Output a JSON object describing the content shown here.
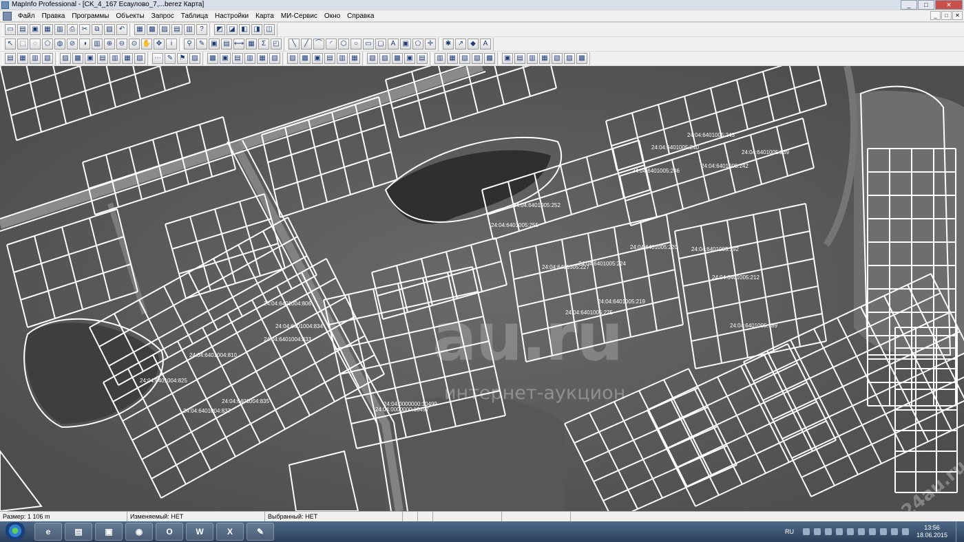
{
  "window": {
    "title": "MapInfo Professional - [CK_4_167 Есаулово_7,...berez Карта]",
    "controls": [
      "_",
      "□",
      "✕"
    ]
  },
  "menu": {
    "items": [
      "Файл",
      "Правка",
      "Программы",
      "Объекты",
      "Запрос",
      "Таблица",
      "Настройки",
      "Карта",
      "МИ-Сервис",
      "Окно",
      "Справка"
    ],
    "mdi_controls": [
      "_",
      "□",
      "✕"
    ]
  },
  "toolbars": {
    "row1": [
      {
        "name": "new-button",
        "glyph": "▭"
      },
      {
        "name": "open-button",
        "glyph": "▤"
      },
      {
        "name": "save-button",
        "glyph": "▣"
      },
      {
        "name": "save-copy-button",
        "glyph": "▦"
      },
      {
        "name": "print-preview-button",
        "glyph": "▥"
      },
      {
        "name": "print-button",
        "glyph": "⎙"
      },
      {
        "name": "cut-button",
        "glyph": "✂"
      },
      {
        "name": "copy-button",
        "glyph": "⧉"
      },
      {
        "name": "paste-button",
        "glyph": "▧"
      },
      {
        "name": "undo-button",
        "glyph": "↶"
      },
      {
        "name": "new-browser-button",
        "glyph": "▦"
      },
      {
        "name": "new-map-button",
        "glyph": "▩"
      },
      {
        "name": "new-graph-button",
        "glyph": "▨"
      },
      {
        "name": "new-layout-button",
        "glyph": "▤"
      },
      {
        "name": "new-redistrict-button",
        "glyph": "▥"
      },
      {
        "name": "help-button",
        "glyph": "?"
      },
      {
        "name": "tool-a-button",
        "glyph": "◩"
      },
      {
        "name": "tool-b-button",
        "glyph": "◪"
      },
      {
        "name": "tool-c-button",
        "glyph": "◧"
      },
      {
        "name": "tool-d-button",
        "glyph": "◨"
      },
      {
        "name": "tool-e-button",
        "glyph": "◫"
      }
    ],
    "row2": [
      {
        "name": "select-tool",
        "glyph": "↖"
      },
      {
        "name": "marquee-select-tool",
        "glyph": "⬚"
      },
      {
        "name": "radius-select-tool",
        "glyph": "◌"
      },
      {
        "name": "polygon-select-tool",
        "glyph": "⬠"
      },
      {
        "name": "boundary-select-tool",
        "glyph": "◍"
      },
      {
        "name": "unselect-all-tool",
        "glyph": "⊘"
      },
      {
        "name": "invert-selection-tool",
        "glyph": "◑"
      },
      {
        "name": "graph-select-tool",
        "glyph": "▥"
      },
      {
        "name": "zoom-in-tool",
        "glyph": "⊕"
      },
      {
        "name": "zoom-out-tool",
        "glyph": "⊖"
      },
      {
        "name": "change-view-tool",
        "glyph": "⊙"
      },
      {
        "name": "grabber-tool",
        "glyph": "✋"
      },
      {
        "name": "center-tool",
        "glyph": "✥"
      },
      {
        "name": "info-tool",
        "glyph": "i"
      },
      {
        "name": "hotlink-tool",
        "glyph": "⚲"
      },
      {
        "name": "label-tool",
        "glyph": "✎"
      },
      {
        "name": "drag-window-tool",
        "glyph": "▣"
      },
      {
        "name": "layer-control-button",
        "glyph": "▤"
      },
      {
        "name": "ruler-tool",
        "glyph": "⟷"
      },
      {
        "name": "show-legend-button",
        "glyph": "▦"
      },
      {
        "name": "statistics-button",
        "glyph": "Σ"
      },
      {
        "name": "clip-region-button",
        "glyph": "◰"
      },
      {
        "name": "symbol-tool",
        "glyph": "╲"
      },
      {
        "name": "line-tool",
        "glyph": "╱"
      },
      {
        "name": "polyline-tool",
        "glyph": "⌒"
      },
      {
        "name": "arc-tool",
        "glyph": "◜"
      },
      {
        "name": "polygon-tool",
        "glyph": "⬡"
      },
      {
        "name": "ellipse-tool",
        "glyph": "○"
      },
      {
        "name": "rectangle-tool",
        "glyph": "▭"
      },
      {
        "name": "rounded-rect-tool",
        "glyph": "▢"
      },
      {
        "name": "text-tool",
        "glyph": "A"
      },
      {
        "name": "frame-tool",
        "glyph": "▣"
      },
      {
        "name": "reshape-tool",
        "glyph": "⬠"
      },
      {
        "name": "add-node-tool",
        "glyph": "✛"
      },
      {
        "name": "symbol-style-button",
        "glyph": "✱"
      },
      {
        "name": "line-style-button",
        "glyph": "↗"
      },
      {
        "name": "region-style-button",
        "glyph": "◆"
      },
      {
        "name": "text-style-button",
        "glyph": "A"
      }
    ],
    "row3": [
      {
        "name": "tool-01",
        "glyph": "▤"
      },
      {
        "name": "tool-02",
        "glyph": "▦"
      },
      {
        "name": "tool-03",
        "glyph": "▥"
      },
      {
        "name": "tool-04",
        "glyph": "▧"
      },
      {
        "name": "tool-05",
        "glyph": "▨"
      },
      {
        "name": "tool-06",
        "glyph": "▩"
      },
      {
        "name": "tool-07",
        "glyph": "▣"
      },
      {
        "name": "tool-08",
        "glyph": "▤"
      },
      {
        "name": "tool-09",
        "glyph": "▥"
      },
      {
        "name": "tool-10",
        "glyph": "▦"
      },
      {
        "name": "tool-11",
        "glyph": "▧"
      },
      {
        "name": "tool-12",
        "glyph": "⋯"
      },
      {
        "name": "tool-13",
        "glyph": "✎"
      },
      {
        "name": "tool-14",
        "glyph": "⚑"
      },
      {
        "name": "tool-15",
        "glyph": "▨"
      },
      {
        "name": "tool-16",
        "glyph": "▩"
      },
      {
        "name": "tool-17",
        "glyph": "▣"
      },
      {
        "name": "tool-18",
        "glyph": "▤"
      },
      {
        "name": "tool-19",
        "glyph": "▥"
      },
      {
        "name": "tool-20",
        "glyph": "▦"
      },
      {
        "name": "tool-21",
        "glyph": "▧"
      },
      {
        "name": "tool-22",
        "glyph": "▨"
      },
      {
        "name": "tool-23",
        "glyph": "▩"
      },
      {
        "name": "tool-24",
        "glyph": "▣"
      },
      {
        "name": "tool-25",
        "glyph": "▤"
      },
      {
        "name": "tool-26",
        "glyph": "▥"
      },
      {
        "name": "tool-27",
        "glyph": "▦"
      },
      {
        "name": "tool-28",
        "glyph": "▧"
      },
      {
        "name": "tool-29",
        "glyph": "▨"
      },
      {
        "name": "tool-30",
        "glyph": "▩"
      },
      {
        "name": "tool-31",
        "glyph": "▣"
      },
      {
        "name": "tool-32",
        "glyph": "▤"
      },
      {
        "name": "tool-33",
        "glyph": "▥"
      },
      {
        "name": "tool-34",
        "glyph": "▦"
      },
      {
        "name": "tool-35",
        "glyph": "▧"
      },
      {
        "name": "tool-36",
        "glyph": "▨"
      },
      {
        "name": "tool-37",
        "glyph": "▩"
      },
      {
        "name": "tool-38",
        "glyph": "▣"
      },
      {
        "name": "tool-39",
        "glyph": "▤"
      },
      {
        "name": "tool-40",
        "glyph": "▥"
      },
      {
        "name": "tool-41",
        "glyph": "▦"
      },
      {
        "name": "tool-42",
        "glyph": "▧"
      },
      {
        "name": "tool-43",
        "glyph": "▨"
      },
      {
        "name": "tool-44",
        "glyph": "▩"
      }
    ]
  },
  "map": {
    "labels": [
      "24:04:6401005:243",
      "24:04:6401005:240",
      "24:04:6401005:239",
      "24:04:6401005:242",
      "24:04:6401005:246",
      "24:04:6401005:252",
      "24:04:6401005:255",
      "24:04:6401005:220",
      "24:04:6401005:192",
      "24:04:6401005:227",
      "24:04:6401005:224",
      "24:04:6401005:212",
      "24:04:6401005:219",
      "24:04:6401005:225",
      "24:04:6401005:189",
      "24:04:6401004:806",
      "24:04:6401004:834",
      "24:04:6401004:833",
      "24:04:6401004:810",
      "24:04:6401004:825",
      "24:04:6401004:835",
      "24:04:6401004:837",
      "24:04:0000000:10499",
      "24:04:0000000:10497"
    ],
    "watermark": {
      "main": "au.ru",
      "sub": "интернет-аукцион",
      "corner": "24au.ru"
    }
  },
  "status": {
    "size": "Размер: 1 106 m",
    "editable": "Изменяемый: НЕТ",
    "selected": "Выбранный: НЕТ"
  },
  "taskbar": {
    "apps": [
      {
        "name": "ie-task",
        "glyph": "e"
      },
      {
        "name": "explorer-task",
        "glyph": "▤"
      },
      {
        "name": "app-task",
        "glyph": "▣"
      },
      {
        "name": "red-app-task",
        "glyph": "◉"
      },
      {
        "name": "opera-task",
        "glyph": "O"
      },
      {
        "name": "word-task",
        "glyph": "W"
      },
      {
        "name": "excel-task",
        "glyph": "X"
      },
      {
        "name": "mapinfo-task",
        "glyph": "✎"
      }
    ],
    "lang": "RU",
    "time": "13:56",
    "date": "18.06.2015"
  }
}
